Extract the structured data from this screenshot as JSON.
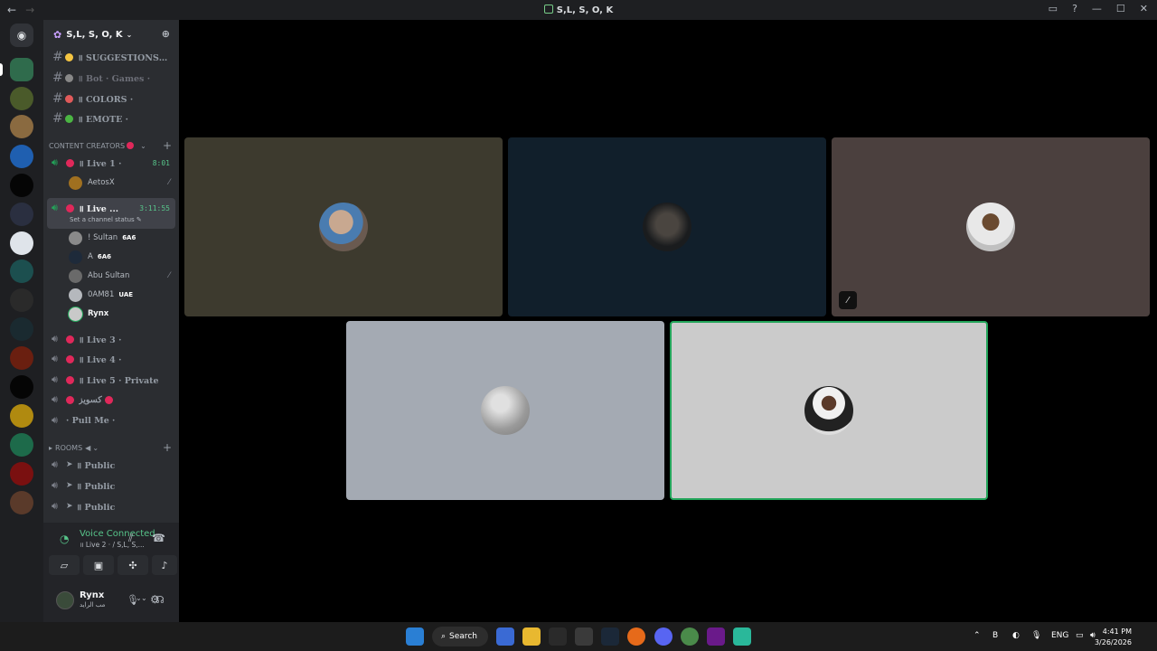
{
  "window": {
    "title": "S,L, S, O, K"
  },
  "server": {
    "name": "S,L, S, O, K"
  },
  "text_channels": [
    {
      "name": "॥ SUGGESTIONS…",
      "emoji_color": "#f5c542"
    },
    {
      "name": "॥ Bot · Games ·",
      "emoji_color": "#888888"
    },
    {
      "name": "॥ COLORS ·",
      "emoji_color": "#e05a5a"
    },
    {
      "name": "॥ EMOTE ·",
      "emoji_color": "#4bb543"
    }
  ],
  "categories": {
    "content_creators": "CONTENT CREATORS",
    "rooms": "ROOMS"
  },
  "voice_channels": {
    "live1": {
      "name": "॥ Live 1 ·",
      "timer": "8:01"
    },
    "live2": {
      "name": "॥ Live ...",
      "timer": "3:11:55",
      "status": "Set a channel status"
    },
    "live3": {
      "name": "॥ Live 3 ·"
    },
    "live4": {
      "name": "॥ Live 4 ·"
    },
    "live5": {
      "name": "॥ Live 5 · Private"
    },
    "ar": {
      "name": "كسويز"
    },
    "pullme": {
      "name": "· Pull Me ·"
    },
    "public1": {
      "name": "॥ Public"
    },
    "public2": {
      "name": "॥ Public"
    },
    "public3": {
      "name": "॥ Public"
    }
  },
  "live1_users": [
    {
      "name": "AetosX"
    }
  ],
  "live2_users": [
    {
      "name": "! Sultan",
      "tag": "6A6"
    },
    {
      "name": "A",
      "tag": "6A6"
    },
    {
      "name": "Abu Sultan",
      "tag": ""
    },
    {
      "name": "0AM81",
      "tag": "UAE"
    },
    {
      "name": "Rynx",
      "tag": ""
    }
  ],
  "voice_panel": {
    "title": "Voice Connected",
    "subtitle": "॥ Live 2 · / S,L, S,..."
  },
  "user": {
    "name": "Rynx",
    "status": "مب الرايد"
  },
  "taskbar": {
    "search": "Search",
    "lang": "ENG",
    "time": "4:41 PM",
    "date": "3/26/2026"
  },
  "colors": {
    "accent_green": "#23a55a",
    "sidebar": "#2b2d31",
    "rail": "#1e1f22"
  }
}
